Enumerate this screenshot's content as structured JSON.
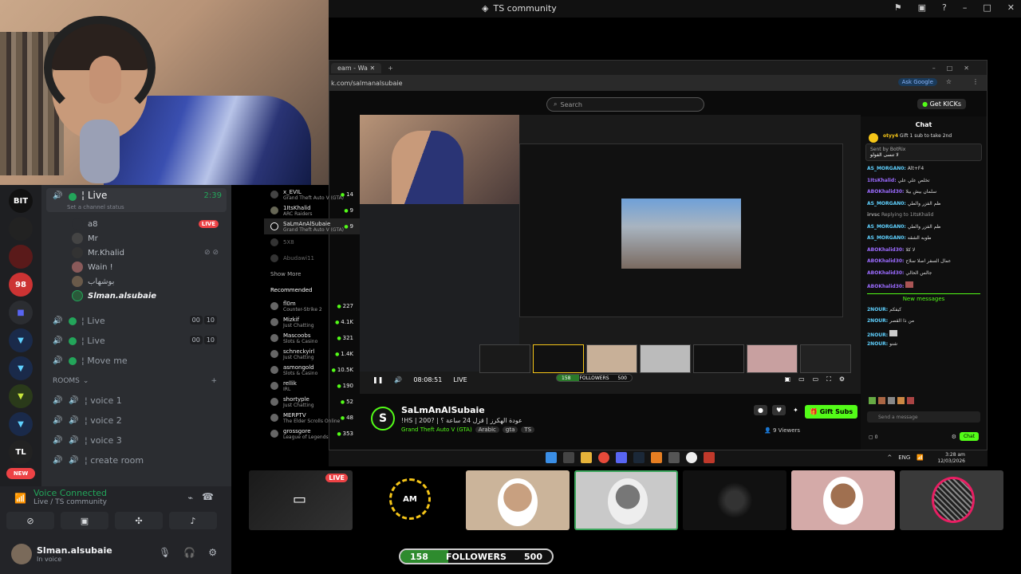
{
  "window": {
    "title": "TS community"
  },
  "discord": {
    "rail": [
      {
        "label": "BIT",
        "color": "#111"
      },
      {
        "label": "",
        "color": "#222"
      },
      {
        "label": "",
        "color": "#3a1a1a"
      },
      {
        "label": "98",
        "color": "#b33"
      },
      {
        "label": "",
        "color": "#2b2d31"
      },
      {
        "label": "",
        "color": "#1e3a6a"
      },
      {
        "label": "",
        "color": "#1e3a6a"
      },
      {
        "label": "",
        "color": "#3a4a1e"
      },
      {
        "label": "",
        "color": "#1e3a6a"
      },
      {
        "label": "TL",
        "color": "#222"
      },
      {
        "label": "NEW",
        "color": "#ed4245"
      }
    ],
    "live_channel": {
      "name": "¦ Live",
      "time": "2:39",
      "status_placeholder": "Set a channel status"
    },
    "users": [
      {
        "name": "a8",
        "live": "LIVE"
      },
      {
        "name": "Mr",
        "live": ""
      },
      {
        "name": "Mr.Khalid",
        "live": ""
      },
      {
        "name": "Wain !",
        "live": ""
      },
      {
        "name": "بوشهاب",
        "live": ""
      },
      {
        "name": "Slman.alsubaie",
        "live": ""
      }
    ],
    "channels": [
      {
        "name": "¦ Live",
        "a": "00",
        "b": "10"
      },
      {
        "name": "¦ Live",
        "a": "00",
        "b": "10"
      },
      {
        "name": "¦ Move me",
        "a": "",
        "b": ""
      }
    ],
    "rooms_header": "ROOMS",
    "rooms": [
      "¦ voice 1",
      "¦ voice 2",
      "¦ voice 3",
      "¦ create room"
    ],
    "voice": {
      "title": "Voice Connected",
      "sub": "Live / TS community"
    },
    "me": {
      "name": "Slman.alsubaie",
      "status": "In voice"
    }
  },
  "browser": {
    "tab": "eam - Wa",
    "url": "k.com/salmanalsubaie",
    "ask_google": "Ask Google",
    "search_placeholder": "Search",
    "get_kicks": "Get KICKs",
    "following": [
      {
        "name": "x_EVIL",
        "sub": "Grand Theft Auto V (GTA)",
        "count": "14"
      },
      {
        "name": "1ItsKhalid",
        "sub": "ARC Raiders",
        "count": "9"
      },
      {
        "name": "SaLmAnAlSubaie",
        "sub": "Grand Theft Auto V (GTA)",
        "count": "9"
      },
      {
        "name": "5X8",
        "sub": "",
        "count": ""
      },
      {
        "name": "Abudawi11",
        "sub": "",
        "count": ""
      }
    ],
    "show_more": "Show More",
    "recommended_header": "Recommended",
    "recommended": [
      {
        "name": "fl0m",
        "sub": "Counter-Strike 2",
        "count": "227"
      },
      {
        "name": "Mizkif",
        "sub": "Just Chatting",
        "count": "4.1K"
      },
      {
        "name": "Mascoobs",
        "sub": "Slots & Casino",
        "count": "321"
      },
      {
        "name": "schneckyirl",
        "sub": "Just Chatting",
        "count": "1.4K"
      },
      {
        "name": "asmongold",
        "sub": "Slots & Casino",
        "count": "10.5K"
      },
      {
        "name": "rellik",
        "sub": "IRL",
        "count": "190"
      },
      {
        "name": "shortyple",
        "sub": "Just Chatting",
        "count": "52"
      },
      {
        "name": "MERPTV",
        "sub": "The Elder Scrolls Online",
        "count": "48"
      },
      {
        "name": "grossgore",
        "sub": "League of Legends",
        "count": "353"
      }
    ],
    "player": {
      "time": "08:08:51",
      "live": "LIVE",
      "followers_label": "FOLLOWERS",
      "followers_current": "158",
      "followers_goal": "500"
    },
    "stream": {
      "name": "SaLmAnAlSubaie",
      "title": "!HS | 200? | عودة الهكرز | قزل 24 ساعة ؟",
      "category": "Grand Theft Auto V (GTA)",
      "tags": [
        "Arabic",
        "gta",
        "TS"
      ],
      "viewers": "9 Viewers",
      "gift_subs": "Gift Subs"
    },
    "chat": {
      "title": "Chat",
      "gifter": "otyy4",
      "gift_text": "Gift 1 sub to take 2nd",
      "pinned_by": "Sent by BotRix",
      "pinned_text": "لا تنسى الفولو",
      "messages": [
        {
          "user": "AS_MORGAN0:",
          "text": "Alt+F4"
        },
        {
          "user": "1ItsKhalid:",
          "text": "تخلص علي علي"
        },
        {
          "user": "ABOKhalid30:",
          "text": "سلمان بيش بيلا"
        },
        {
          "user": "AS_MORGAN0:",
          "text": "ظم الفزر والطي"
        },
        {
          "user": "irvsc",
          "text": "Replying to 1ItsKhalid"
        },
        {
          "user": "AS_MORGAN0:",
          "text": "ظم الفزر والطي"
        },
        {
          "user": "AS_MORGAN0:",
          "text": "طوبه الشقه"
        },
        {
          "user": "ABOKhalid30:",
          "text": "لا كلا"
        },
        {
          "user": "ABOKhalid30:",
          "text": "عمال السفر اصلا سلاح"
        },
        {
          "user": "ABOKhalid30:",
          "text": "جالس الحالي"
        },
        {
          "user": "ABOKhalid30:",
          "text": ""
        }
      ],
      "new_messages": "New messages",
      "messages2": [
        {
          "user": "2NOUR:",
          "text": "كيفكم"
        },
        {
          "user": "2NOUR:",
          "text": "من ذا القصر"
        },
        {
          "user": "2NOUR:",
          "text": ""
        },
        {
          "user": "2NOUR:",
          "text": "شنو"
        }
      ],
      "input_placeholder": "Send a message",
      "send": "Chat",
      "count": "0"
    },
    "clock": {
      "time": "3:28 am",
      "date": "12/03/2026"
    },
    "lang": "ENG"
  },
  "bottom": {
    "tile_live": "LIVE",
    "am_label": "AM",
    "followers": {
      "current": "158",
      "label": "FOLLOWERS",
      "goal": "500",
      "progress": 0.316
    }
  }
}
